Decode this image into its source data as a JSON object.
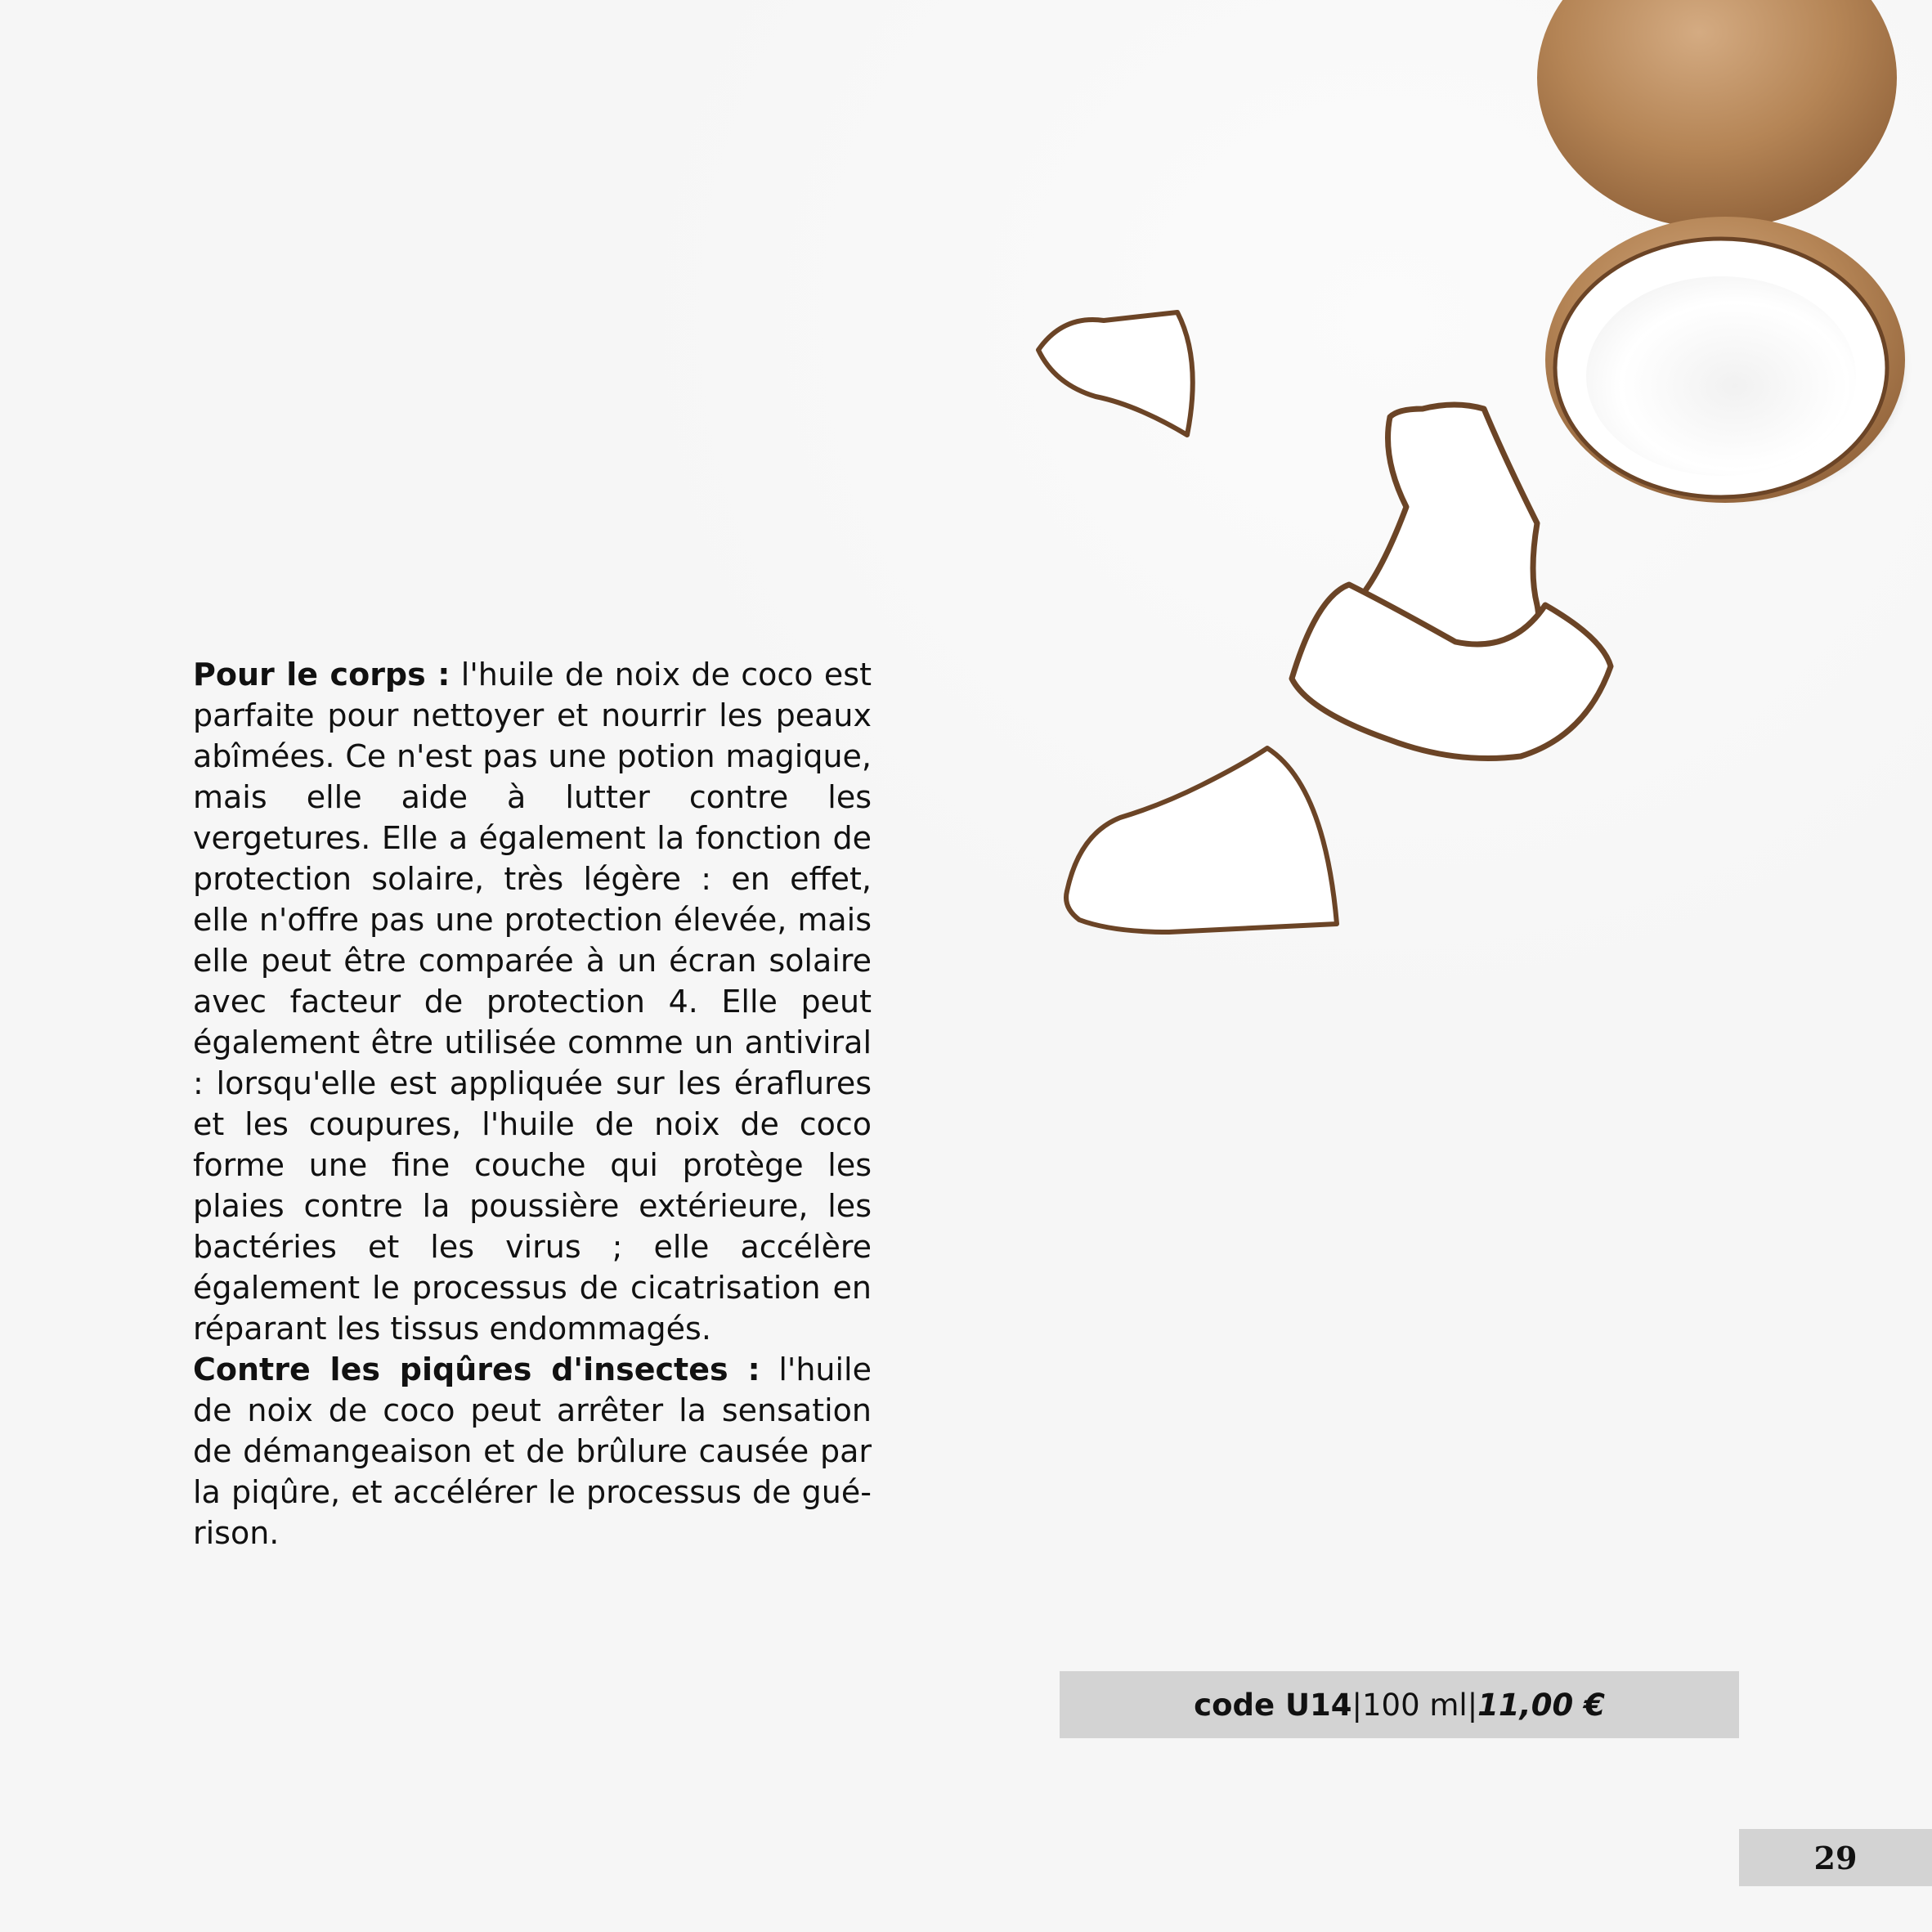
{
  "body": {
    "p1_lead": "Pour le corps :",
    "p1_text": " l'huile de noix de coco est parfaite pour nettoyer et nourrir les peaux abîmées. Ce n'est pas une potion magique, mais elle aide à lutter contre les vergetures. Elle a également la fonction de protection solaire, très légère : en effet, elle n'offre pas une protection élevée, mais elle peut être comparée à un écran solaire avec facteur de protection 4. Elle peut également être utilisée comme un antiviral : lorsqu'elle est appliquée sur les éraflures et les cou­pures, l'huile de noix de coco forme une fine couche qui protège les plaies contre la poussière extérieure, les bactéries et les virus ; elle accélère également le processus de cicatrisation en réparant les tissus en­dommagés.",
    "p2_lead": "Contre les piqûres d'insectes :",
    "p2_text": "  l'huile de noix de coco peut arrêter la sensation de démangeaison et de brûlure causée par la piqûre, et accélérer le processus de gué­rison."
  },
  "product": {
    "code": "code U14",
    "sep1": " | ",
    "volume": "100 ml",
    "sep2": " | ",
    "price": "11,00 €"
  },
  "page_number": "29",
  "image": {
    "subject": "coconut pieces",
    "colors": {
      "shell": "#8a5a34",
      "flesh": "#ffffff",
      "husk": "#b98b5e"
    }
  }
}
